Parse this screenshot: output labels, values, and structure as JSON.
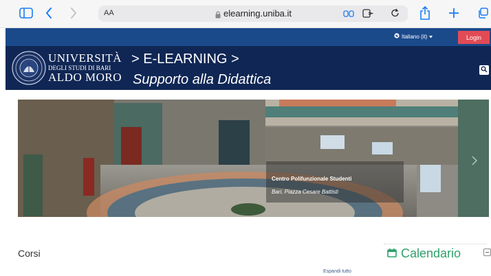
{
  "browser": {
    "text_size_label": "AA",
    "url": "elearning.uniba.it"
  },
  "topnav": {
    "language": "Italiano (it)",
    "login_label": "Login"
  },
  "header": {
    "university_line1": "UNIVERSITÀ",
    "university_line2": "DEGLI STUDI DI BARI",
    "university_line3": "ALDO MORO",
    "breadcrumb": "> E-LEARNING >",
    "subtitle": "Supporto alla Didattica"
  },
  "hero": {
    "caption_title": "Centro Polifunzionale Studenti",
    "caption_subtitle": "Bari, Piazza Cesare Battisti"
  },
  "main": {
    "section_title": "Corsi",
    "expand_all": "Espandi tutto"
  },
  "calendar": {
    "title": "Calendario"
  },
  "colors": {
    "topnav_bg": "#1b4a8b",
    "header_bg": "#102755",
    "login_bg": "#e24b55",
    "accent_green": "#2fa06b",
    "browser_blue": "#1a7cf5"
  }
}
